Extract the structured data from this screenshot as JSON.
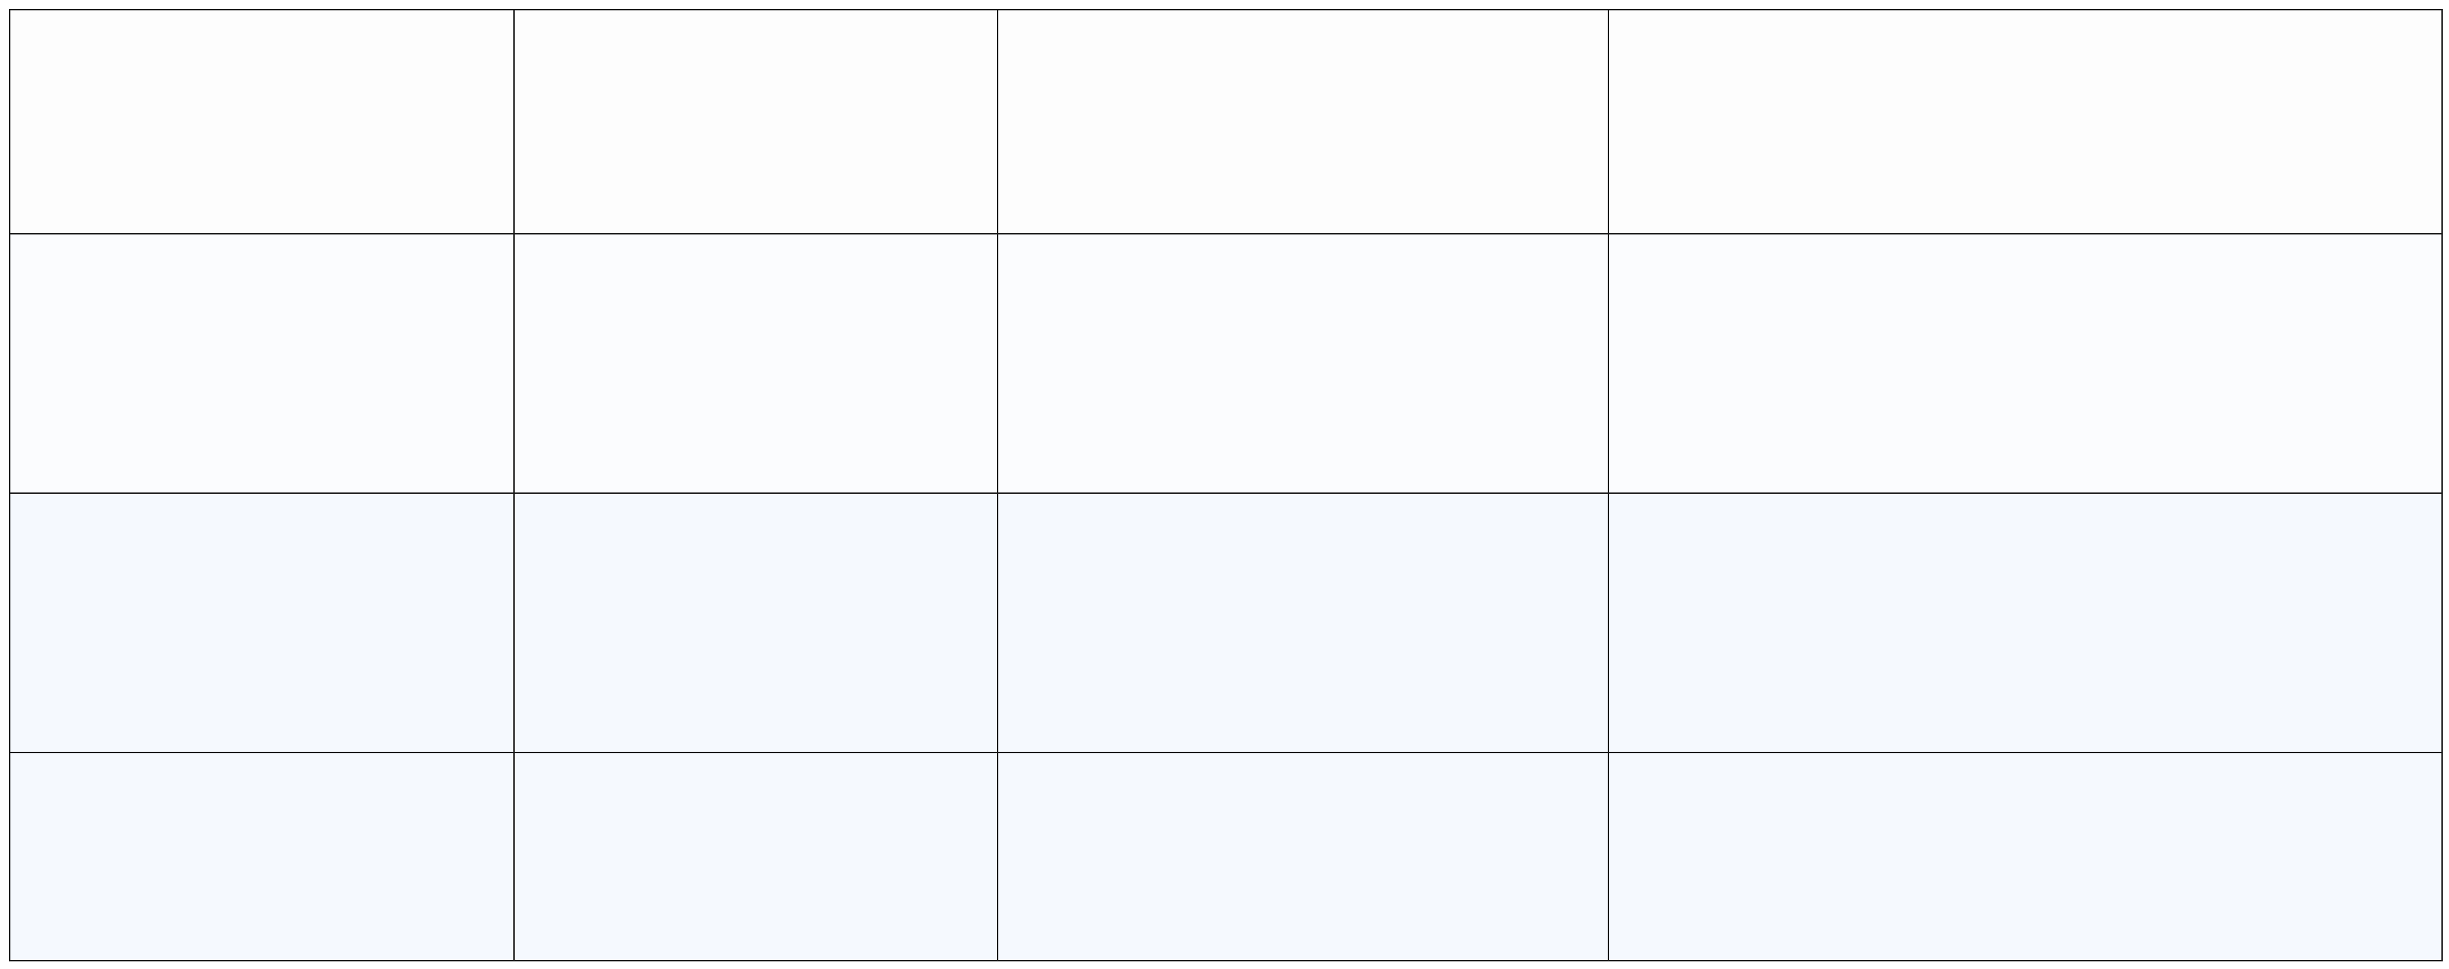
{
  "table": {
    "rows": [
      [
        "",
        "",
        "",
        ""
      ],
      [
        "",
        "",
        "",
        ""
      ],
      [
        "",
        "",
        "",
        ""
      ],
      [
        "",
        "",
        "",
        ""
      ]
    ]
  },
  "colors": {
    "border": "#1a1a1a",
    "row_backgrounds": [
      "#fdfdfd",
      "#fbfcfe",
      "#f5f9fe",
      "#f5f9fe"
    ]
  }
}
